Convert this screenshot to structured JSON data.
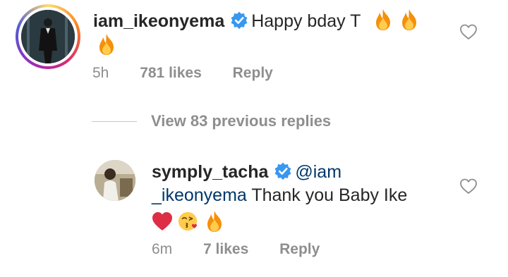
{
  "comment": {
    "username": "iam_ikeonyema",
    "text": "Happy bday T",
    "time": "5h",
    "likes": "781 likes",
    "reply_label": "Reply"
  },
  "view_replies": "View 83 previous replies",
  "reply": {
    "username": "symply_tacha",
    "mention_part1": "@iam",
    "mention_part2": "_ikeonyema",
    "text": "Thank you Baby Ike",
    "time": "6m",
    "likes": "7 likes",
    "reply_label": "Reply"
  },
  "colors": {
    "verified": "#3897f0",
    "mention": "#00376b",
    "meta": "#8e8e8e"
  },
  "icons": [
    "verified-badge-icon",
    "fire-emoji",
    "red-heart-emoji",
    "face-blowing-kiss-emoji",
    "heart-outline-icon"
  ]
}
